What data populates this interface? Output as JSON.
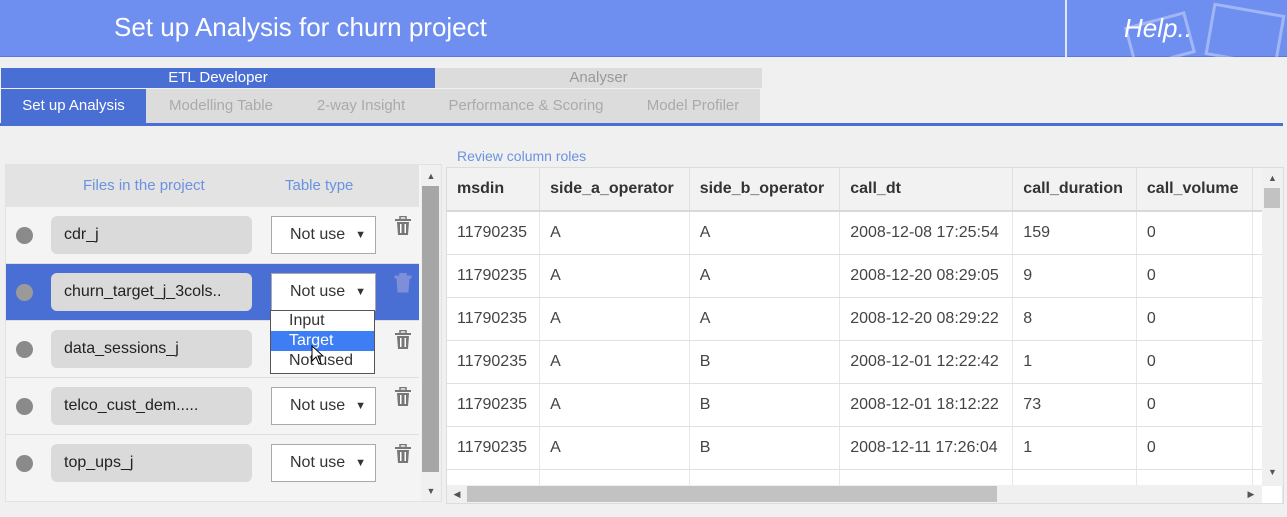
{
  "header": {
    "title": "Set up Analysis for churn project",
    "help": "Help.."
  },
  "roles": {
    "etl": "ETL Developer",
    "analyser": "Analyser"
  },
  "tabs": [
    {
      "label": "Set up Analysis",
      "active": true
    },
    {
      "label": "Modelling Table",
      "active": false
    },
    {
      "label": "2-way Insight",
      "active": false
    },
    {
      "label": "Performance & Scoring",
      "active": false
    },
    {
      "label": "Model Profiler",
      "active": false
    }
  ],
  "files_panel": {
    "col_files": "Files in the project",
    "col_type": "Table type",
    "files": [
      {
        "name": "cdr_j",
        "type": "Not use",
        "selected": false
      },
      {
        "name": "churn_target_j_3cols..",
        "type": "Not use",
        "selected": true
      },
      {
        "name": "data_sessions_j",
        "type": "",
        "selected": false
      },
      {
        "name": "telco_cust_dem.....",
        "type": "Not use",
        "selected": false
      },
      {
        "name": "top_ups_j",
        "type": "Not use",
        "selected": false
      }
    ]
  },
  "dropdown": {
    "options": [
      "Input",
      "Target",
      "Not used"
    ],
    "highlighted": "Target"
  },
  "review": {
    "title": "Review column roles",
    "columns": [
      "msdin",
      "side_a_operator",
      "side_b_operator",
      "call_dt",
      "call_duration",
      "call_volume"
    ],
    "rows": [
      [
        "11790235",
        "A",
        "A",
        "2008-12-08 17:25:54",
        "159",
        "0"
      ],
      [
        "11790235",
        "A",
        "A",
        "2008-12-20 08:29:05",
        "9",
        "0"
      ],
      [
        "11790235",
        "A",
        "A",
        "2008-12-20 08:29:22",
        "8",
        "0"
      ],
      [
        "11790235",
        "A",
        "B",
        "2008-12-01 12:22:42",
        "1",
        "0"
      ],
      [
        "11790235",
        "A",
        "B",
        "2008-12-01 18:12:22",
        "73",
        "0"
      ],
      [
        "11790235",
        "A",
        "B",
        "2008-12-11 17:26:04",
        "1",
        "0"
      ],
      [
        "",
        "",
        "",
        "",
        "",
        ""
      ]
    ]
  },
  "colors": {
    "header_bg": "#6f8ff0",
    "accent": "#4a6fd4",
    "link": "#6a92e0",
    "dropdown_highlight": "#3d7ef5"
  },
  "icons": {
    "trash": "trash-icon",
    "dot": "status-dot-icon",
    "arrow": "chevron-down-icon"
  }
}
